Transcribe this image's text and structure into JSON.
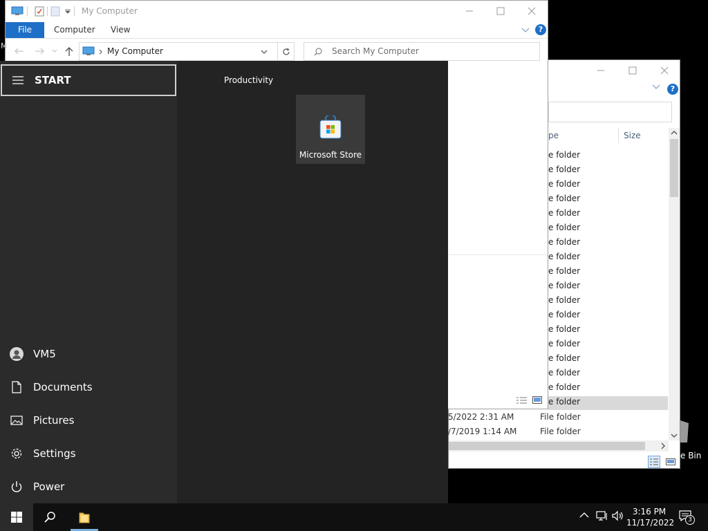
{
  "explorer_back": {
    "type_header": "pe",
    "size_header": "Size",
    "rows": [
      "e folder",
      "e folder",
      "e folder",
      "e folder",
      "e folder",
      "e folder",
      "e folder",
      "e folder",
      "e folder",
      "e folder",
      "e folder",
      "e folder",
      "e folder",
      "e folder",
      "e folder",
      "e folder",
      "e folder",
      "e folder"
    ],
    "extra_rows": [
      {
        "date": "5/2022 2:31 AM",
        "type": "File folder"
      },
      {
        "date": "/7/2019 1:14 AM",
        "type": "File folder"
      }
    ],
    "desktop_label": "e Bin"
  },
  "explorer_front": {
    "title": "My Computer",
    "tabs": [
      "File",
      "Computer",
      "View"
    ],
    "address": "My Computer",
    "search_placeholder": "Search My Computer",
    "left_cut_text": "M"
  },
  "start_menu": {
    "header": "START",
    "group_title": "Productivity",
    "tile_label": "Microsoft Store",
    "items": [
      {
        "label": "VM5",
        "icon": "user-icon"
      },
      {
        "label": "Documents",
        "icon": "document-icon"
      },
      {
        "label": "Pictures",
        "icon": "pictures-icon"
      },
      {
        "label": "Settings",
        "icon": "gear-icon"
      },
      {
        "label": "Power",
        "icon": "power-icon"
      }
    ]
  },
  "taskbar": {
    "time": "3:16 PM",
    "date": "11/17/2022",
    "notification_count": "3"
  },
  "colors": {
    "accent": "#1e6fc7",
    "start_bg": "#232323",
    "start_side": "#2b2b2b",
    "taskbar": "#101010"
  }
}
